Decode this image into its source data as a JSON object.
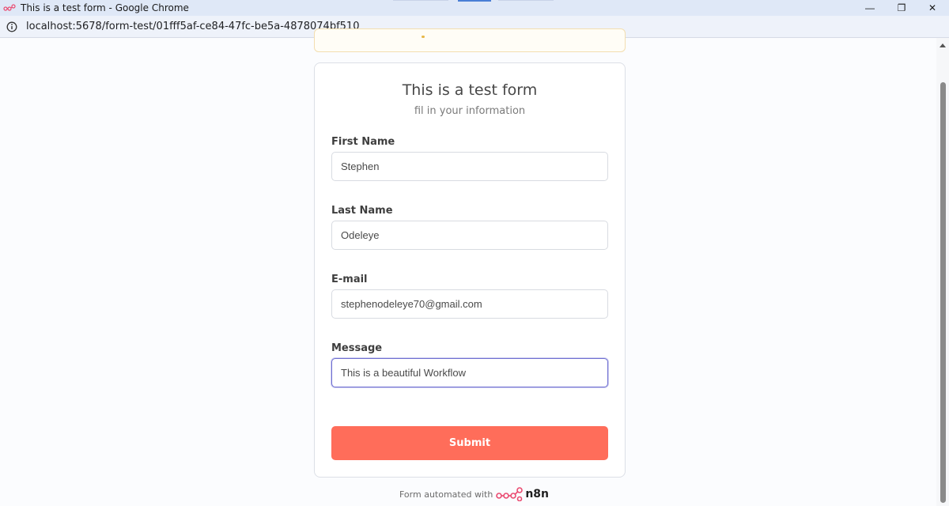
{
  "window": {
    "title": "This is a test form - Google Chrome",
    "minimize_glyph": "—",
    "restore_glyph": "❐",
    "close_glyph": "✕"
  },
  "address_bar": {
    "url": "localhost:5678/form-test/01fff5af-ce84-47fc-be5a-4878074bf510",
    "icon": "info-icon"
  },
  "form": {
    "title": "This is a test form",
    "subtitle": "fil in your information",
    "fields": [
      {
        "label": "First Name",
        "value": "Stephen"
      },
      {
        "label": "Last Name",
        "value": "Odeleye"
      },
      {
        "label": "E-mail",
        "value": "stephenodeleye70@gmail.com"
      },
      {
        "label": "Message",
        "value": "This is a beautiful Workflow"
      }
    ],
    "submit_label": "Submit"
  },
  "footer": {
    "text": "Form automated with",
    "brand": "n8n",
    "logo_icon": "n8n-logo-icon"
  },
  "colors": {
    "accent": "#ff6d5a",
    "focus_border": "#6f6fd2",
    "page_bg": "#fbfcfe",
    "titlebar_bg": "#dfe8f7"
  }
}
